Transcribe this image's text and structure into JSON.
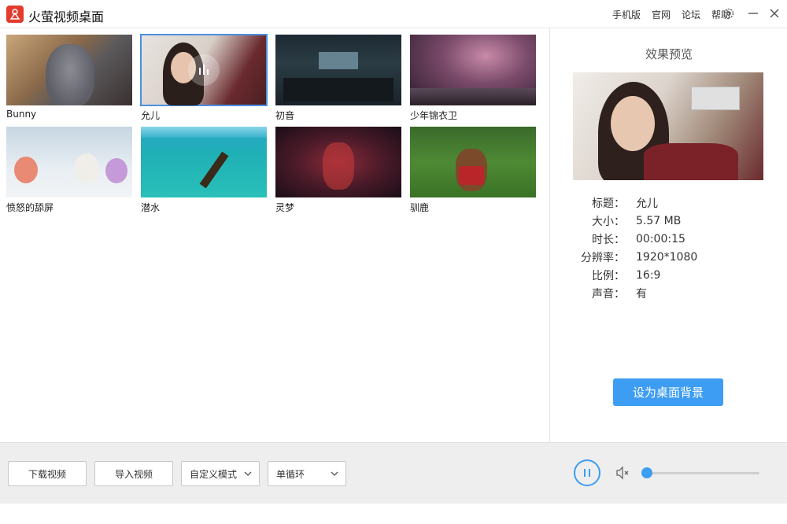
{
  "app": {
    "title": "火萤视频桌面"
  },
  "nav": {
    "mobile": "手机版",
    "official": "官网",
    "forum": "论坛",
    "help": "帮助"
  },
  "icons": {
    "settings": "gear-icon",
    "minimize": "minimize-icon",
    "close": "close-icon"
  },
  "videos": [
    {
      "name": "Bunny",
      "selected": false
    },
    {
      "name": "允儿",
      "selected": true
    },
    {
      "name": "初音",
      "selected": false
    },
    {
      "name": "少年锦衣卫",
      "selected": false
    },
    {
      "name": "愤怒的舔屏",
      "selected": false
    },
    {
      "name": "潜水",
      "selected": false
    },
    {
      "name": "灵梦",
      "selected": false
    },
    {
      "name": "驯鹿",
      "selected": false
    }
  ],
  "preview": {
    "title": "效果预览",
    "info": [
      {
        "label": "标题：",
        "value": "允儿"
      },
      {
        "label": "大小：",
        "value": "5.57 MB"
      },
      {
        "label": "时长：",
        "value": "00:00:15"
      },
      {
        "label": "分辨率：",
        "value": "1920*1080"
      },
      {
        "label": "比例：",
        "value": "16:9"
      },
      {
        "label": "声音：",
        "value": "有"
      }
    ],
    "set_bg_label": "设为桌面背景"
  },
  "toolbar": {
    "download_label": "下载视频",
    "import_label": "导入视频",
    "mode_value": "自定义模式",
    "loop_value": "单循环",
    "volume": 0,
    "accent": "#3d9df2"
  }
}
